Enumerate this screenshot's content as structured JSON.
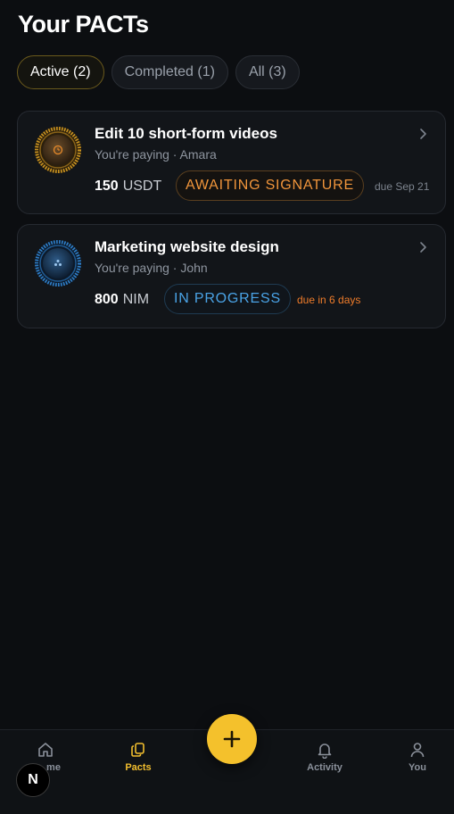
{
  "header": {
    "title": "Your PACTs"
  },
  "tabs": [
    {
      "label": "Active (2)",
      "selected": true
    },
    {
      "label": "Completed (1)",
      "selected": false
    },
    {
      "label": "All (3)",
      "selected": false
    }
  ],
  "pacts": [
    {
      "title": "Edit 10 short-form videos",
      "subtitle": "You're paying · Amara",
      "amount": "150",
      "currency": "USDT",
      "status": "AWAITING SIGNATURE",
      "status_color": "#f0953b",
      "due": "due Sep 21",
      "emblem_icon": "gold-dial-emblem-icon"
    },
    {
      "title": "Marketing website design",
      "subtitle": "You're paying · John",
      "amount": "800",
      "currency": "NIM",
      "status": "IN PROGRESS",
      "status_color": "#4aa3e6",
      "due": "due in 6 days",
      "emblem_icon": "blue-dial-emblem-icon"
    }
  ],
  "nav": {
    "items": [
      {
        "label": "me",
        "icon": "home-icon"
      },
      {
        "label": "Pacts",
        "icon": "pacts-icon",
        "active": true
      },
      {
        "label": "Activity",
        "icon": "bell-icon"
      },
      {
        "label": "You",
        "icon": "user-icon"
      }
    ],
    "fab_icon": "plus-icon"
  },
  "overlay_badge": {
    "letter": "N"
  },
  "colors": {
    "accent": "#f4c12c",
    "background": "#0c0e11"
  }
}
